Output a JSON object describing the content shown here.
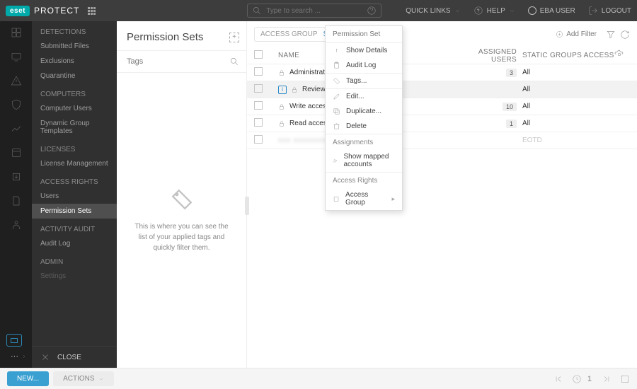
{
  "brand": {
    "badge": "eset",
    "product": "PROTECT"
  },
  "search": {
    "placeholder": "Type to search ..."
  },
  "top": {
    "quick": "QUICK LINKS",
    "help": "HELP",
    "user": "EBA USER",
    "logout": "LOGOUT"
  },
  "nav": {
    "sections": [
      {
        "title": "DETECTIONS",
        "items": [
          "Submitted Files",
          "Exclusions",
          "Quarantine"
        ]
      },
      {
        "title": "COMPUTERS",
        "items": [
          "Computer Users",
          "Dynamic Group Templates"
        ]
      },
      {
        "title": "LICENSES",
        "items": [
          "License Management"
        ]
      },
      {
        "title": "ACCESS RIGHTS",
        "items": [
          "Users",
          "Permission Sets"
        ]
      },
      {
        "title": "ACTIVITY AUDIT",
        "items": [
          "Audit Log"
        ]
      },
      {
        "title": "ADMIN",
        "items": [
          "Settings"
        ]
      }
    ],
    "close": "CLOSE"
  },
  "page_title": "Permission Sets",
  "tags_label": "Tags",
  "tags_empty": "This is where you can see the list of your applied tags and quickly filter them.",
  "filters": {
    "access_group": "ACCESS GROUP",
    "select": "Select",
    "add_filter": "Add Filter"
  },
  "columns": {
    "name": "NAME",
    "assigned": "ASSIGNED USERS",
    "static": "STATIC GROUPS ACCESS"
  },
  "rows": [
    {
      "name": "Administrator permission set",
      "users": "3",
      "groups": "All",
      "locked": true
    },
    {
      "name": "Reviewer permission set",
      "users": "",
      "groups": "All",
      "locked": true,
      "selected": true
    },
    {
      "name": "Write access permission set",
      "users": "10",
      "groups": "All",
      "locked": true
    },
    {
      "name": "Read access permission set",
      "users": "1",
      "groups": "All",
      "locked": true
    },
    {
      "name": "",
      "users": "",
      "groups": "EOTD",
      "locked": false,
      "muted": true
    }
  ],
  "ctx": {
    "title": "Permission Set",
    "show_details": "Show Details",
    "audit_log": "Audit Log",
    "tags": "Tags...",
    "edit": "Edit...",
    "duplicate": "Duplicate...",
    "delete": "Delete",
    "assignments": "Assignments",
    "mapped": "Show mapped accounts",
    "access_rights": "Access Rights",
    "access_group": "Access Group"
  },
  "footer": {
    "new": "NEW...",
    "actions": "ACTIONS",
    "page": "1"
  }
}
